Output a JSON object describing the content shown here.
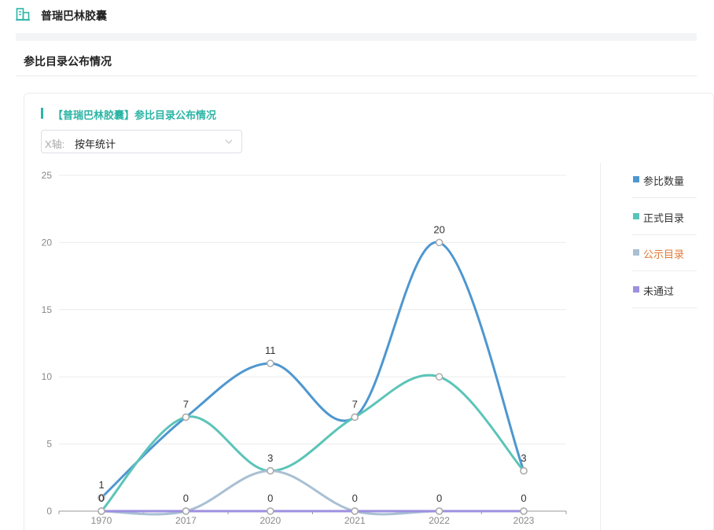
{
  "header": {
    "drug_name": "普瑞巴林胶囊"
  },
  "section": {
    "title": "参比目录公布情况"
  },
  "card": {
    "title": "【普瑞巴林胶囊】参比目录公布情况"
  },
  "axis_select": {
    "prefix": "X轴:",
    "value": "按年统计"
  },
  "legend": [
    {
      "label": "参比数量",
      "color": "#4e97d0",
      "label_color": "#333333"
    },
    {
      "label": "正式目录",
      "color": "#5bc4b8",
      "label_color": "#333333"
    },
    {
      "label": "公示目录",
      "color": "#a9bfd3",
      "label_color": "#e07b39"
    },
    {
      "label": "未通过",
      "color": "#9e8fe0",
      "label_color": "#333333"
    }
  ],
  "chart_data": {
    "type": "line",
    "smooth": true,
    "categories": [
      "1970",
      "2017",
      "2020",
      "2021",
      "2022",
      "2023"
    ],
    "ylim": [
      0,
      25
    ],
    "yticks": [
      0,
      5,
      10,
      15,
      20,
      25
    ],
    "grid": true,
    "legend_position": "right",
    "series": [
      {
        "name": "参比数量",
        "color": "#4e97d0",
        "values": [
          1,
          7,
          11,
          7,
          20,
          3
        ],
        "show_labels": true
      },
      {
        "name": "正式目录",
        "color": "#5bc4b8",
        "values": [
          0,
          7,
          3,
          7,
          10,
          3
        ],
        "show_labels": false
      },
      {
        "name": "公示目录",
        "color": "#a9bfd3",
        "values": [
          0,
          0,
          3,
          0,
          0,
          0
        ],
        "show_labels": true
      },
      {
        "name": "未通过",
        "color": "#9e8fe0",
        "values": [
          0,
          0,
          0,
          0,
          0,
          0
        ],
        "show_labels": true
      }
    ]
  }
}
